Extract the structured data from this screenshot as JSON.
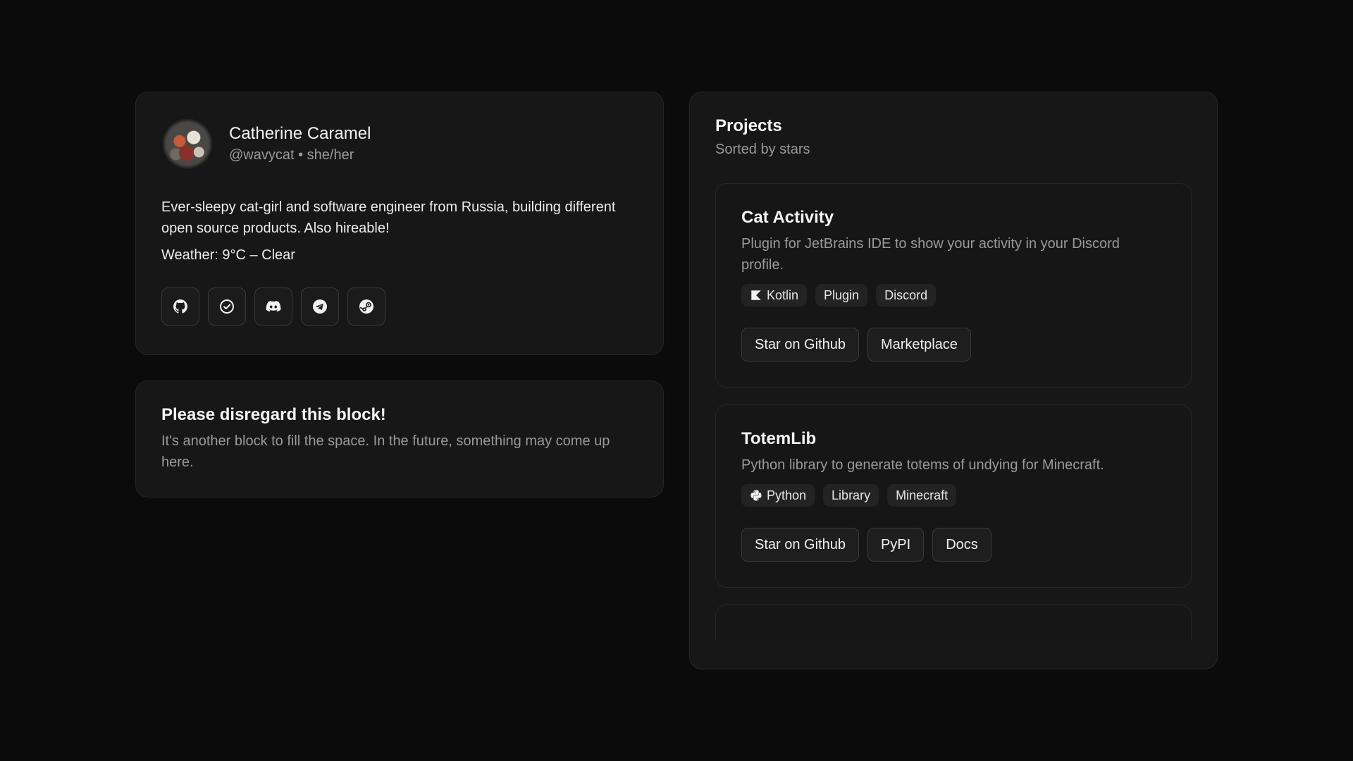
{
  "profile": {
    "name": "Catherine Caramel",
    "handle": "@wavycat • she/her",
    "bio": "Ever-sleepy cat-girl and software engineer from Russia, building different open source products. Also hireable!",
    "weather": "Weather: 9°C – Clear",
    "socials": [
      {
        "icon": "github-icon"
      },
      {
        "icon": "check-circle-icon"
      },
      {
        "icon": "discord-icon"
      },
      {
        "icon": "telegram-icon"
      },
      {
        "icon": "steam-icon"
      }
    ]
  },
  "filler": {
    "title": "Please disregard this block!",
    "text": "It's another block to fill the space. In the future, something may come up here."
  },
  "projects": {
    "title": "Projects",
    "subtitle": "Sorted by stars",
    "items": [
      {
        "title": "Cat Activity",
        "description": "Plugin for JetBrains IDE to show your activity in your Discord profile.",
        "tags": [
          {
            "label": "Kotlin",
            "icon": "kotlin-icon"
          },
          {
            "label": "Plugin"
          },
          {
            "label": "Discord"
          }
        ],
        "actions": [
          "Star on Github",
          "Marketplace"
        ]
      },
      {
        "title": "TotemLib",
        "description": "Python library to generate totems of undying for Minecraft.",
        "tags": [
          {
            "label": "Python",
            "icon": "python-icon"
          },
          {
            "label": "Library"
          },
          {
            "label": "Minecraft"
          }
        ],
        "actions": [
          "Star on Github",
          "PyPI",
          "Docs"
        ]
      }
    ]
  }
}
